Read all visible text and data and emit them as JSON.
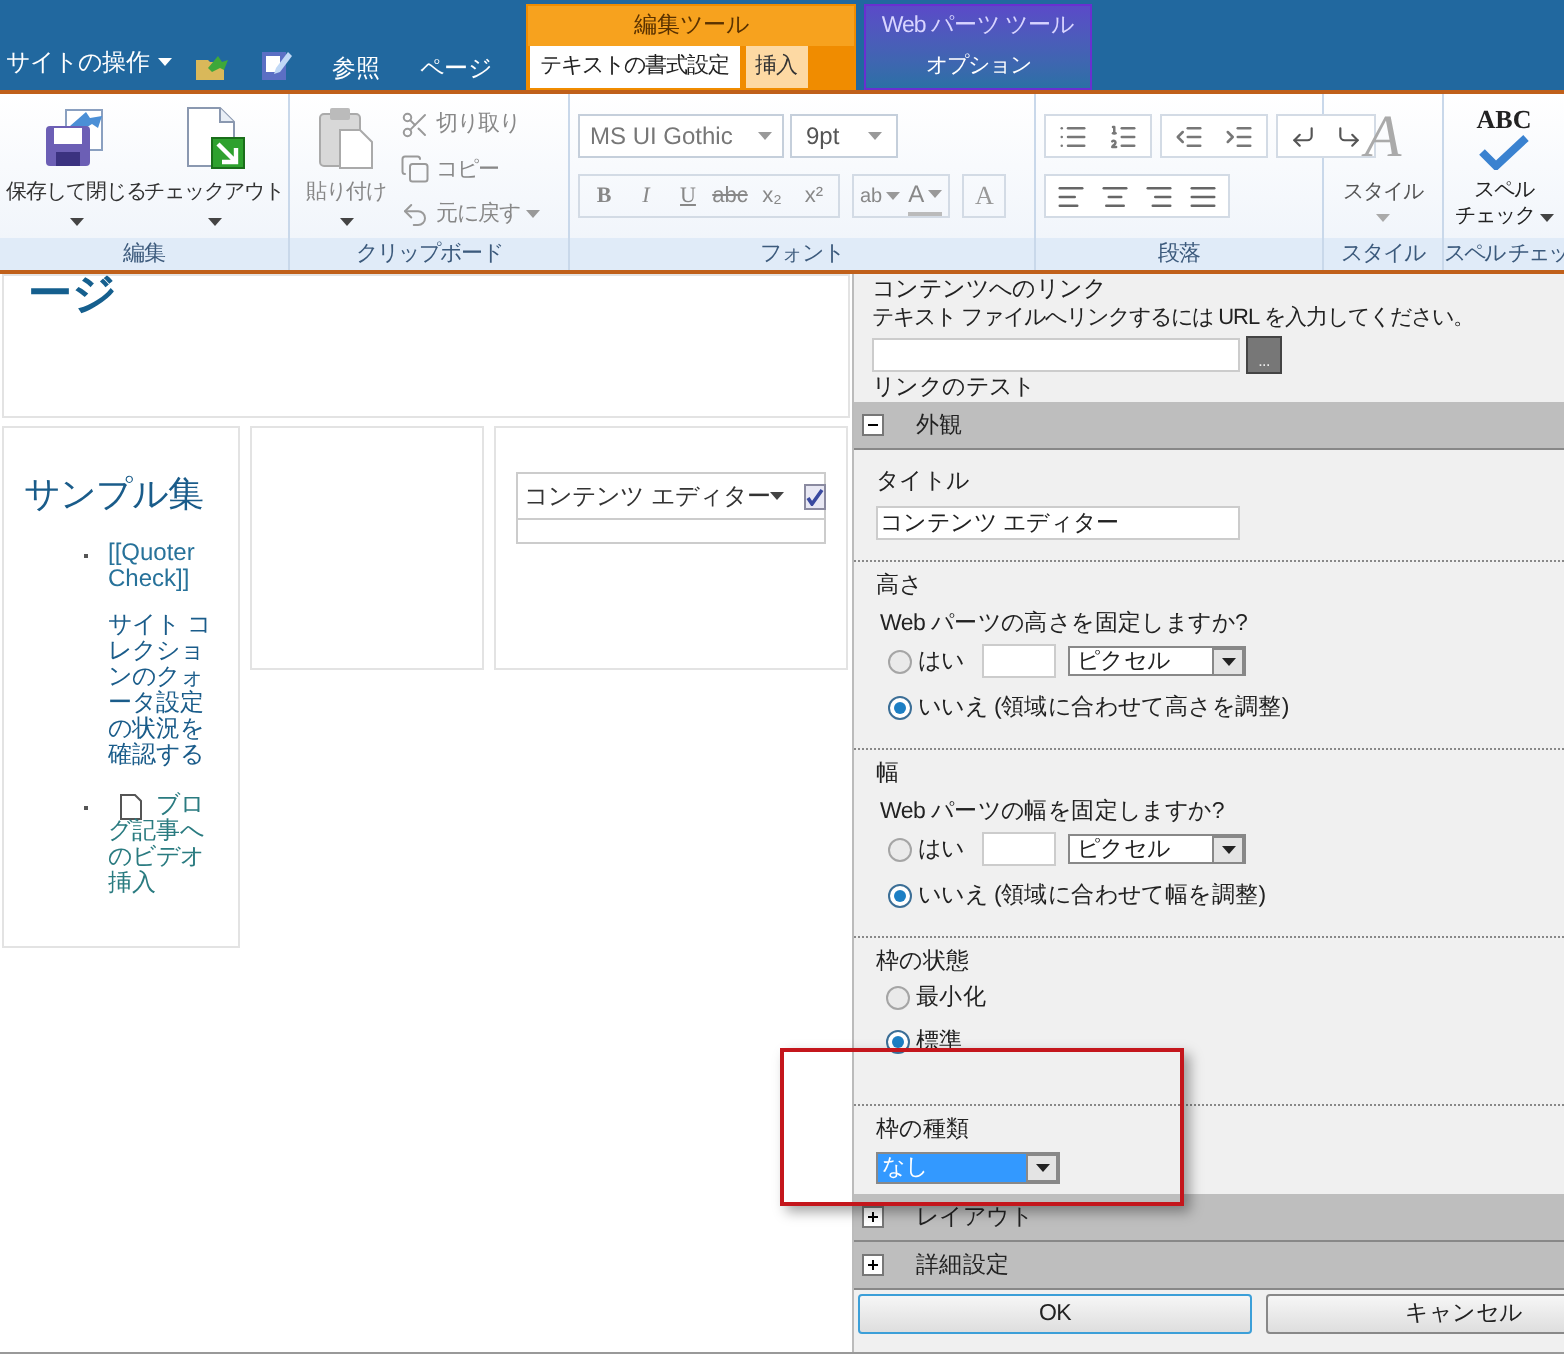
{
  "top_bar": {
    "site_actions": "サイトの操作",
    "tabs": [
      {
        "label": "参照",
        "selected": false
      },
      {
        "label": "ページ",
        "selected": false
      }
    ]
  },
  "contextual_groups": [
    {
      "kind": "edit_tools",
      "title": "編集ツール",
      "tabs": [
        {
          "label": "テキストの書式設定",
          "selected": true
        },
        {
          "label": "挿入",
          "selected": false
        }
      ]
    },
    {
      "kind": "web_part_tools",
      "title": "Web パーツ ツール",
      "tabs": [
        {
          "label": "オプション",
          "selected": false
        }
      ]
    }
  ],
  "ribbon": {
    "edit": {
      "label": "編集",
      "buttons": [
        {
          "kind": "save",
          "label": "保存して閉じる"
        },
        {
          "kind": "checkout",
          "label": "チェックアウト"
        }
      ]
    },
    "clipboard": {
      "label": "クリップボード",
      "paste": {
        "label": "貼り付け",
        "disabled": true
      },
      "small_buttons": [
        {
          "kind": "cut",
          "label": "切り取り",
          "disabled": true
        },
        {
          "kind": "copy",
          "label": "コピー",
          "disabled": true
        },
        {
          "kind": "undo",
          "label": "元に戻す",
          "disabled": true
        }
      ]
    },
    "font": {
      "label": "フォント",
      "font_name": "MS UI Gothic",
      "font_size": "9pt",
      "format_buttons": [
        {
          "kind": "bold",
          "glyph": "B"
        },
        {
          "kind": "italic",
          "glyph": "I"
        },
        {
          "kind": "underline",
          "glyph": "U"
        },
        {
          "kind": "strike",
          "glyph": "abc"
        },
        {
          "kind": "subscript",
          "glyph": "x₂"
        },
        {
          "kind": "superscript",
          "glyph": "x²"
        }
      ],
      "highlight_glyph": "ab",
      "color_glyph": "A",
      "clear_glyph": "A"
    },
    "paragraph": {
      "label": "段落"
    },
    "styles": {
      "label": "スタイル",
      "glyph": "A",
      "button": "スタイル"
    },
    "spelling": {
      "label": "スペル チェッ",
      "glyph": "ABC",
      "button": [
        "スペル",
        "チェック"
      ]
    }
  },
  "page": {
    "title": "ージ",
    "sample": {
      "heading": "サンプル集",
      "items": [
        {
          "kind": "link_with_description",
          "link": "[[Quoter Check]]",
          "description": "サイト コレクションのクォータ設定の状況を確認する"
        },
        {
          "kind": "document_link",
          "link": "ブログ記事へのビデオ挿入"
        }
      ]
    },
    "web_part": {
      "title": "コンテンツ エディター",
      "checked": true
    }
  },
  "tool_pane": {
    "link": {
      "label": "コンテンツへのリンク",
      "hint": "テキスト ファイルへリンクするには URL を入力してください。",
      "browse_button": "...",
      "test_link": "リンクのテスト"
    },
    "appearance": {
      "title": "外観",
      "expanded": true,
      "title_field": {
        "label": "タイトル",
        "value": "コンテンツ エディター"
      },
      "height": {
        "label": "高さ",
        "question": "Web パーツの高さを固定しますか?",
        "options": [
          {
            "kind": "fixed",
            "label": "はい",
            "unit": "ピクセル",
            "selected": false
          },
          {
            "kind": "auto",
            "label": "いいえ (領域に合わせて高さを調整)",
            "selected": true
          }
        ]
      },
      "width": {
        "label": "幅",
        "question": "Web パーツの幅を固定しますか?",
        "options": [
          {
            "kind": "fixed",
            "label": "はい",
            "unit": "ピクセル",
            "selected": false
          },
          {
            "kind": "auto",
            "label": "いいえ (領域に合わせて幅を調整)",
            "selected": true
          }
        ]
      },
      "chrome_state": {
        "label": "枠の状態",
        "options": [
          {
            "label": "最小化",
            "selected": false
          },
          {
            "label": "標準",
            "selected": true
          }
        ]
      },
      "chrome_type": {
        "label": "枠の種類",
        "value": "なし"
      }
    },
    "collapsed_sections": [
      {
        "title": "レイアウト",
        "expanded": false
      },
      {
        "title": "詳細設定",
        "expanded": false
      }
    ],
    "buttons": [
      {
        "kind": "ok",
        "label": "OK"
      },
      {
        "kind": "cancel",
        "label": "キャンセル"
      }
    ]
  }
}
